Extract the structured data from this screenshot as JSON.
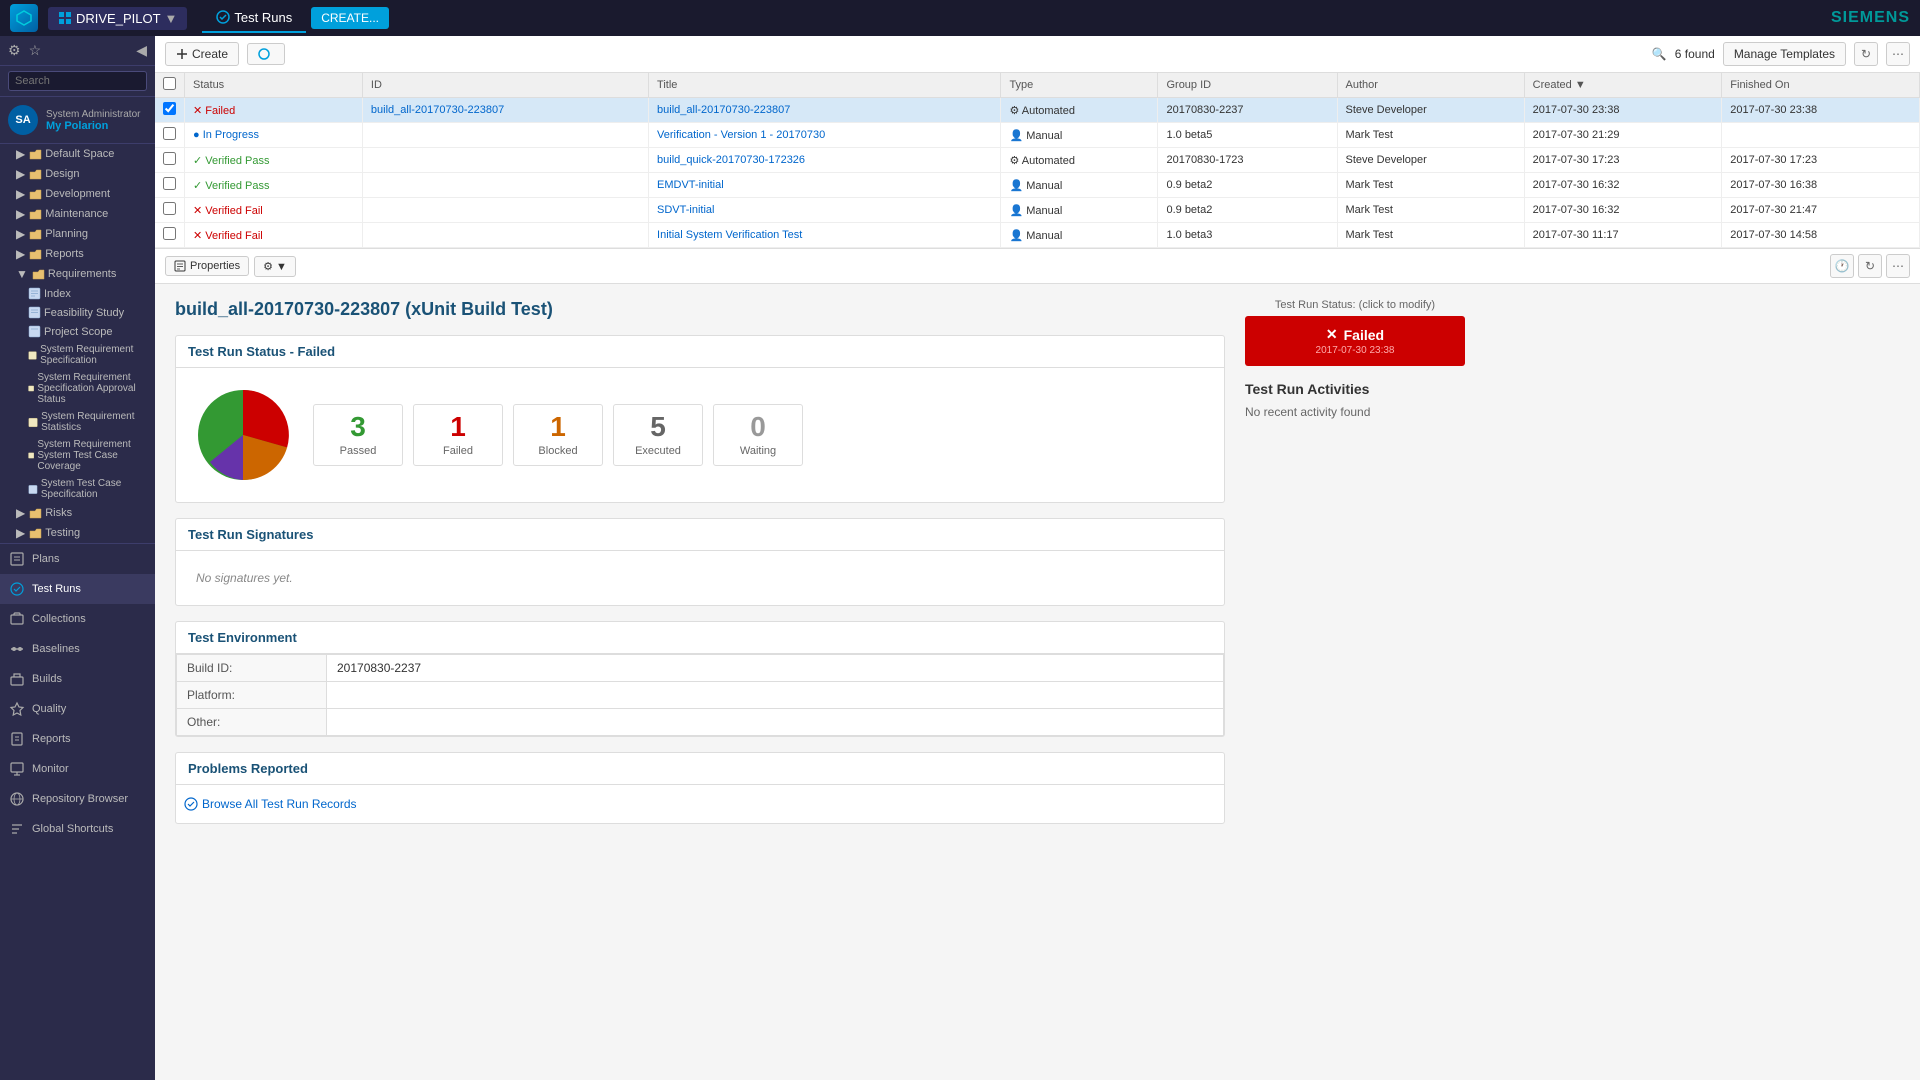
{
  "app": {
    "logo_text": "S",
    "app_name": "DRIVE_PILOT",
    "app_icon": "car",
    "siemens_label": "SIEMENS",
    "nav_tabs": [
      {
        "label": "Test Runs",
        "active": true
      },
      {
        "label": "CREATE...",
        "is_button": true
      }
    ]
  },
  "toolbar": {
    "create_label": "Create",
    "found_label": "6 found",
    "manage_templates_label": "Manage Templates"
  },
  "table": {
    "columns": [
      "Status",
      "ID",
      "Title",
      "Type",
      "Group ID",
      "Author",
      "Created",
      "Finished On"
    ],
    "rows": [
      {
        "selected": true,
        "status": "Failed",
        "status_type": "failed",
        "id": "build_all-20170730-223807",
        "title": "build_all-20170730-223807",
        "type": "Automated",
        "group_id": "20170830-2237",
        "author": "Steve Developer",
        "created": "2017-07-30 23:38",
        "finished": "2017-07-30 23:38"
      },
      {
        "selected": false,
        "status": "In Progress",
        "status_type": "inprogress",
        "id": "",
        "title": "Verification - Version 1 - 20170730",
        "type": "Manual",
        "group_id": "1.0 beta5",
        "author": "Mark Test",
        "created": "2017-07-30 21:29",
        "finished": ""
      },
      {
        "selected": false,
        "status": "Verified Pass",
        "status_type": "passed",
        "id": "",
        "title": "build_quick-20170730-172326",
        "type": "Automated",
        "group_id": "20170830-1723",
        "author": "Steve Developer",
        "created": "2017-07-30 17:23",
        "finished": "2017-07-30 17:23"
      },
      {
        "selected": false,
        "status": "Verified Pass",
        "status_type": "passed",
        "id": "",
        "title": "EMDVT-initial",
        "type": "Manual",
        "group_id": "0.9 beta2",
        "author": "Mark Test",
        "created": "2017-07-30 16:32",
        "finished": "2017-07-30 16:38"
      },
      {
        "selected": false,
        "status": "Verified Fail",
        "status_type": "failed",
        "id": "",
        "title": "SDVT-initial",
        "type": "Manual",
        "group_id": "0.9 beta2",
        "author": "Mark Test",
        "created": "2017-07-30 16:32",
        "finished": "2017-07-30 21:47"
      },
      {
        "selected": false,
        "status": "Verified Fail",
        "status_type": "failed",
        "id": "",
        "title": "Initial System Verification Test",
        "type": "Manual",
        "group_id": "1.0 beta3",
        "author": "Mark Test",
        "created": "2017-07-30 11:17",
        "finished": "2017-07-30 14:58"
      }
    ]
  },
  "detail": {
    "properties_label": "Properties",
    "title": "build_all-20170730-223807 (xUnit Build Test)",
    "status_section_header": "Test Run Status - Failed",
    "stats": {
      "passed": {
        "value": "3",
        "label": "Passed"
      },
      "failed": {
        "value": "1",
        "label": "Failed"
      },
      "blocked": {
        "value": "1",
        "label": "Blocked"
      },
      "executed": {
        "value": "5",
        "label": "Executed"
      },
      "waiting": {
        "value": "0",
        "label": "Waiting"
      }
    },
    "test_run_status_label": "Test Run Status: (click to modify)",
    "status_badge": "Failed",
    "status_date": "2017-07-30 23:38",
    "activities_title": "Test Run Activities",
    "activities_empty": "No recent activity found",
    "signatures_header": "Test Run Signatures",
    "no_signatures": "No signatures yet.",
    "environment_header": "Test Environment",
    "environment_fields": [
      {
        "label": "Build ID:",
        "value": "20170830-2237"
      },
      {
        "label": "Platform:",
        "value": ""
      },
      {
        "label": "Other:",
        "value": ""
      }
    ],
    "problems_header": "Problems Reported",
    "problems_link": "Browse All Test Run Records"
  },
  "sidebar": {
    "user_initials": "SA",
    "user_name": "System Administrator",
    "user_project": "My Polarion",
    "search_placeholder": "Search",
    "nav_items": [
      {
        "label": "Default Space",
        "icon": "folder",
        "indent": 1
      },
      {
        "label": "Design",
        "icon": "folder",
        "indent": 1
      },
      {
        "label": "Development",
        "icon": "folder",
        "indent": 1
      },
      {
        "label": "Maintenance",
        "icon": "folder",
        "indent": 1
      },
      {
        "label": "Planning",
        "icon": "folder",
        "indent": 1
      },
      {
        "label": "Reports",
        "icon": "folder",
        "indent": 1
      },
      {
        "label": "Requirements",
        "icon": "folder",
        "indent": 1,
        "expanded": true
      },
      {
        "label": "Index",
        "icon": "doc",
        "indent": 2
      },
      {
        "label": "Feasibility Study",
        "icon": "doc",
        "indent": 2
      },
      {
        "label": "Project Scope",
        "icon": "doc",
        "indent": 2
      },
      {
        "label": "System Requirement Specification",
        "icon": "doc",
        "indent": 2
      },
      {
        "label": "System Requirement Specification Approval Status",
        "icon": "doc",
        "indent": 2
      },
      {
        "label": "System Requirement Statistics",
        "icon": "doc",
        "indent": 2
      },
      {
        "label": "System Requirement System Test Case Coverage",
        "icon": "doc",
        "indent": 2
      },
      {
        "label": "System Test Case Specification",
        "icon": "doc",
        "indent": 2
      },
      {
        "label": "Risks",
        "icon": "folder",
        "indent": 1
      },
      {
        "label": "Testing",
        "icon": "folder",
        "indent": 1
      },
      {
        "label": "Plans",
        "icon": "plans",
        "indent": 0
      },
      {
        "label": "Test Runs",
        "icon": "testruns",
        "indent": 0,
        "active": true
      },
      {
        "label": "Collections",
        "icon": "collections",
        "indent": 0
      },
      {
        "label": "Baselines",
        "icon": "baselines",
        "indent": 0
      },
      {
        "label": "Builds",
        "icon": "builds",
        "indent": 0
      },
      {
        "label": "Quality",
        "icon": "quality",
        "indent": 0
      },
      {
        "label": "Reports",
        "icon": "reports2",
        "indent": 0
      },
      {
        "label": "Monitor",
        "icon": "monitor",
        "indent": 0
      },
      {
        "label": "Repository Browser",
        "icon": "repo",
        "indent": 0
      },
      {
        "label": "Global Shortcuts",
        "icon": "shortcuts",
        "indent": 0
      }
    ]
  }
}
